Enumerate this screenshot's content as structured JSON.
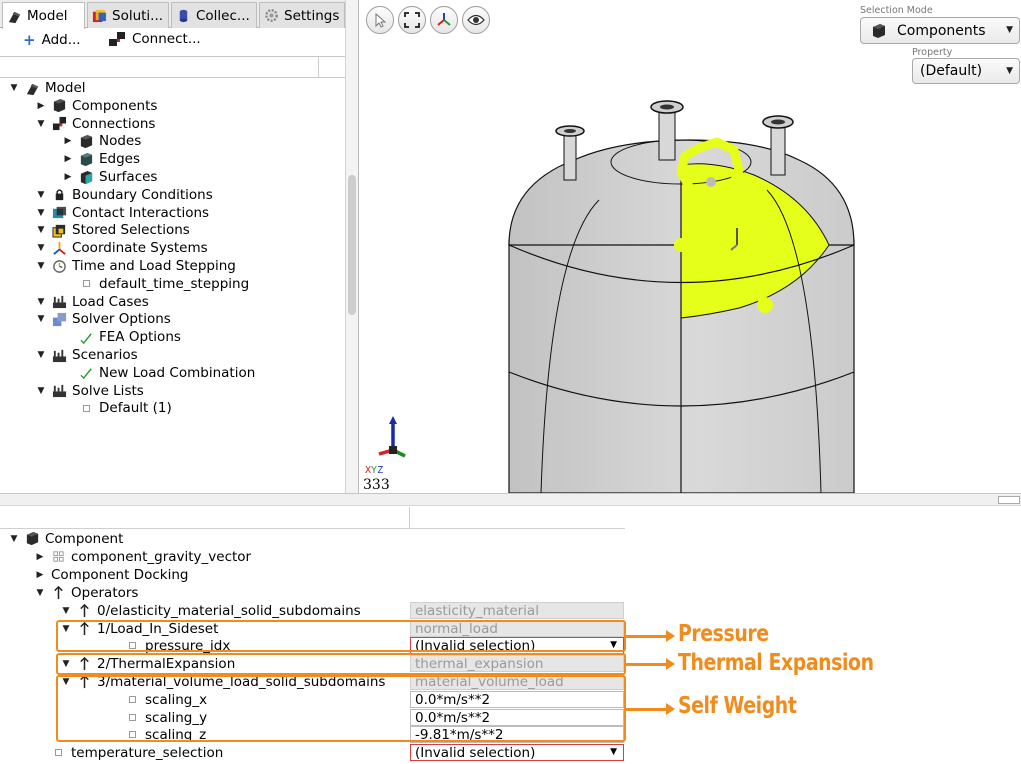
{
  "tabs": [
    {
      "label": "Model",
      "icon": "model-icon",
      "active": true
    },
    {
      "label": "Soluti...",
      "icon": "solution-icon",
      "active": false
    },
    {
      "label": "Collec...",
      "icon": "collection-icon",
      "active": false
    },
    {
      "label": "Settings",
      "icon": "gear-icon",
      "active": false
    }
  ],
  "toolbar": {
    "add_label": "Add...",
    "connect_label": "Connect..."
  },
  "model_tree": [
    {
      "label": "Model",
      "level": 0,
      "arrow": "down",
      "icon": "model-icon"
    },
    {
      "label": "Components",
      "level": 1,
      "arrow": "right",
      "icon": "cube-icon"
    },
    {
      "label": "Connections",
      "level": 1,
      "arrow": "down",
      "icon": "connection-icon"
    },
    {
      "label": "Nodes",
      "level": 2,
      "arrow": "right",
      "icon": "cube-icon"
    },
    {
      "label": "Edges",
      "level": 2,
      "arrow": "right",
      "icon": "edge-cube-icon"
    },
    {
      "label": "Surfaces",
      "level": 2,
      "arrow": "right",
      "icon": "surface-cube-icon"
    },
    {
      "label": "Boundary Conditions",
      "level": 1,
      "arrow": "down",
      "icon": "lock-icon"
    },
    {
      "label": "Contact Interactions",
      "level": 1,
      "arrow": "down",
      "icon": "contact-icon"
    },
    {
      "label": "Stored Selections",
      "level": 1,
      "arrow": "down",
      "icon": "selection-stack-icon"
    },
    {
      "label": "Coordinate Systems",
      "level": 1,
      "arrow": "down",
      "icon": "axes-icon"
    },
    {
      "label": "Time and Load Stepping",
      "level": 1,
      "arrow": "down",
      "icon": "clock-icon"
    },
    {
      "label": "default_time_stepping",
      "level": 2,
      "arrow": "none",
      "icon": "leaf"
    },
    {
      "label": "Load Cases",
      "level": 1,
      "arrow": "down",
      "icon": "load-cases-icon"
    },
    {
      "label": "Solver Options",
      "level": 1,
      "arrow": "down",
      "icon": "solver-icon"
    },
    {
      "label": "FEA Options",
      "level": 2,
      "arrow": "none",
      "icon": "check-icon"
    },
    {
      "label": "Scenarios",
      "level": 1,
      "arrow": "down",
      "icon": "load-cases-icon"
    },
    {
      "label": "New Load Combination",
      "level": 2,
      "arrow": "none",
      "icon": "check-icon"
    },
    {
      "label": "Solve Lists",
      "level": 1,
      "arrow": "down",
      "icon": "load-cases-icon"
    },
    {
      "label": "Default (1)",
      "level": 2,
      "arrow": "none",
      "icon": "leaf"
    }
  ],
  "viewport": {
    "view_buttons": [
      "select-cursor-icon",
      "fit-view-icon",
      "axes-view-icon",
      "visibility-eye-icon"
    ],
    "selection_mode_label": "Selection Mode",
    "selection_mode_value": "Components",
    "property_label": "Property",
    "property_value": "(Default)",
    "axis_letters": {
      "x": "X",
      "y": "Y",
      "z": "Z"
    },
    "axis_number": "333",
    "highlight_color": "#e6ff1a",
    "tank_color": "#d2d2d2"
  },
  "properties": [
    {
      "label": "Component",
      "level": 0,
      "arrow": "down",
      "icon": "cube-icon",
      "value": null
    },
    {
      "label": "component_gravity_vector",
      "level": 1,
      "arrow": "right",
      "icon": "grid-icon",
      "value": null
    },
    {
      "label": "Component Docking",
      "level": 1,
      "arrow": "right",
      "icon": "none",
      "value": null
    },
    {
      "label": "Operators",
      "level": 1,
      "arrow": "down",
      "icon": "operator-icon",
      "value": null
    },
    {
      "label": "0/elasticity_material_solid_subdomains",
      "level": 2,
      "arrow": "down",
      "icon": "operator-icon",
      "value": "elasticity_material",
      "value_type": "grey"
    },
    {
      "label": "1/Load_In_Sideset",
      "level": 2,
      "arrow": "down",
      "icon": "operator-icon",
      "value": "normal_load",
      "value_type": "grey"
    },
    {
      "label": "pressure_idx",
      "level": 3,
      "arrow": "none",
      "icon": "leaf",
      "value": "(Invalid selection)",
      "value_type": "combo"
    },
    {
      "label": "2/ThermalExpansion",
      "level": 2,
      "arrow": "down",
      "icon": "operator-icon",
      "value": "thermal_expansion",
      "value_type": "grey"
    },
    {
      "label": "3/material_volume_load_solid_subdomains",
      "level": 2,
      "arrow": "down",
      "icon": "operator-icon",
      "value": "material_volume_load",
      "value_type": "grey"
    },
    {
      "label": "scaling_x",
      "level": 3,
      "arrow": "none",
      "icon": "leaf",
      "value": "0.0*m/s**2",
      "value_type": "input"
    },
    {
      "label": "scaling_y",
      "level": 3,
      "arrow": "none",
      "icon": "leaf",
      "value": "0.0*m/s**2",
      "value_type": "input"
    },
    {
      "label": "scaling_z",
      "level": 3,
      "arrow": "none",
      "icon": "leaf",
      "value": "-9.81*m/s**2",
      "value_type": "input"
    },
    {
      "label": "temperature_selection",
      "level": 1,
      "arrow": "none",
      "icon": "leaf",
      "value": "(Invalid selection)",
      "value_type": "combo"
    }
  ],
  "annotations": {
    "color": "#f08c1e",
    "pressure": "Pressure",
    "thermal": "Thermal Expansion",
    "self_weight": "Self Weight"
  }
}
